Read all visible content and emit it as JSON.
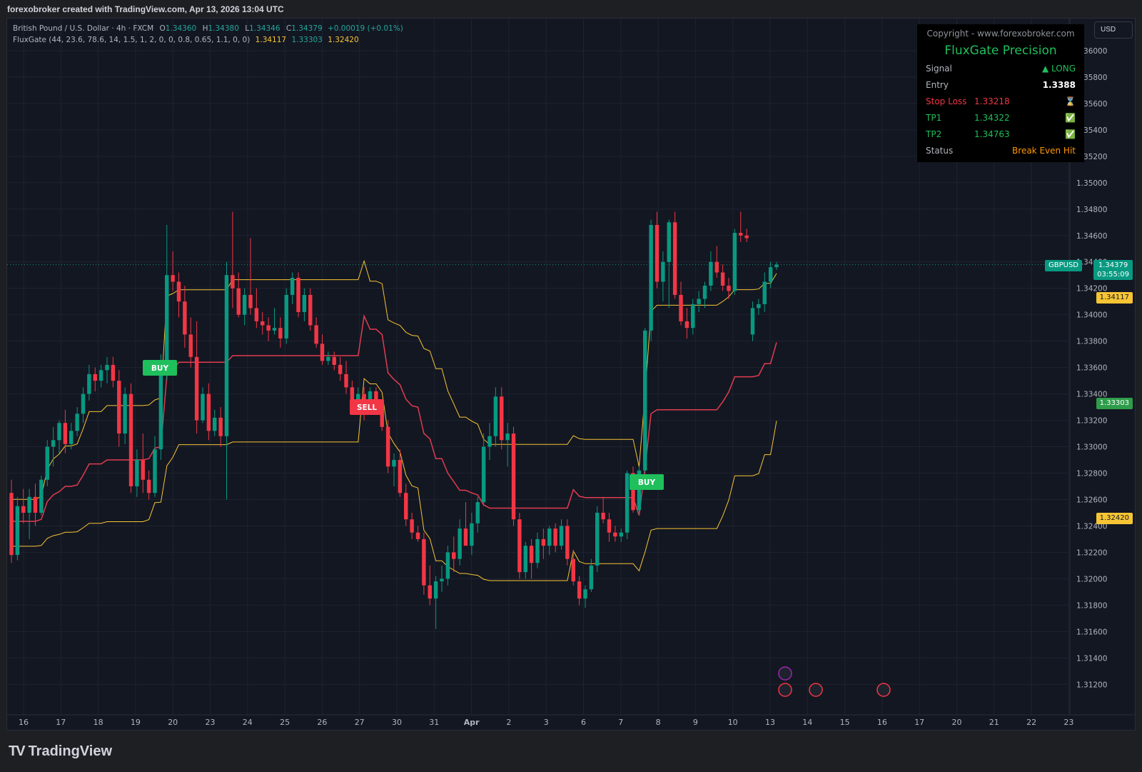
{
  "header": {
    "caption": "forexobroker created with TradingView.com, Apr 13, 2026 13:04 UTC"
  },
  "legend": {
    "symbol_line": "British Pound / U.S. Dollar · 4h · FXCM",
    "o_label": "O",
    "o": "1.34360",
    "h_label": "H",
    "h": "1.34380",
    "l_label": "L",
    "l": "1.34346",
    "c_label": "C",
    "c": "1.34379",
    "change": "+0.00019 (+0.01%)",
    "indicator": "FluxGate (44, 23.6, 78.6, 14, 1.5, 1, 2, 0, 0, 0.8, 0.65, 1.1, 0, 0)",
    "ind_v1": "1.34117",
    "ind_v2": "1.33303",
    "ind_v3": "1.32420"
  },
  "currency_button": "USD",
  "panel": {
    "copyright": "Copyright - www.forexobroker.com",
    "title": "FluxGate Precision",
    "rows": [
      {
        "label": "Signal",
        "mid": "",
        "value": "▲ LONG",
        "color": "#1fbf5c"
      },
      {
        "label": "Entry",
        "mid": "",
        "value": "1.3388",
        "color": "#ffffff"
      },
      {
        "label": "Stop Loss",
        "mid": "1.33218",
        "value": "⌛",
        "color": "#f7c534"
      },
      {
        "label": "TP1",
        "mid": "1.34322",
        "value": "✅",
        "color": "#1fbf5c"
      },
      {
        "label": "TP2",
        "mid": "1.34763",
        "value": "✅",
        "color": "#1fbf5c"
      },
      {
        "label": "Status",
        "mid": "",
        "value": "Break Even Hit",
        "color": "#ff9800"
      }
    ],
    "label_colors": [
      "#b2b5be",
      "#b2b5be",
      "#f23645",
      "#1fbf5c",
      "#1fbf5c",
      "#b2b5be"
    ]
  },
  "price_tags": {
    "symbol": "GBPUSD",
    "last": "1.34379",
    "countdown": "03:55:09",
    "upper": "1.34117",
    "mid": "1.33303",
    "lower": "1.32420"
  },
  "signals": {
    "buy": "BUY",
    "sell": "SELL"
  },
  "footer": {
    "brand": "TradingView"
  },
  "chart_data": {
    "type": "candlestick",
    "timeframe": "4h",
    "ylim": [
      1.3105,
      1.362
    ],
    "y_ticks": [
      "1.36000",
      "1.35800",
      "1.35600",
      "1.35400",
      "1.35200",
      "1.35000",
      "1.34800",
      "1.34600",
      "1.34400",
      "1.34200",
      "1.34000",
      "1.33800",
      "1.33600",
      "1.33400",
      "1.33200",
      "1.33000",
      "1.32800",
      "1.32600",
      "1.32400",
      "1.32200",
      "1.32000",
      "1.31800",
      "1.31600",
      "1.31400",
      "1.31200"
    ],
    "x_ticks": [
      "16",
      "17",
      "18",
      "19",
      "20",
      "23",
      "24",
      "25",
      "26",
      "27",
      "30",
      "31",
      "Apr",
      "2",
      "3",
      "6",
      "7",
      "8",
      "9",
      "10",
      "13",
      "14",
      "15",
      "16",
      "17",
      "20",
      "21",
      "22",
      "23"
    ],
    "last_price": 1.34379,
    "candles": [
      [
        1.3265,
        1.3275,
        1.3212,
        1.3218
      ],
      [
        1.3218,
        1.3262,
        1.3214,
        1.3255
      ],
      [
        1.3255,
        1.3268,
        1.3242,
        1.325
      ],
      [
        1.325,
        1.3268,
        1.323,
        1.3262
      ],
      [
        1.3262,
        1.3272,
        1.324,
        1.325
      ],
      [
        1.325,
        1.3278,
        1.3248,
        1.3275
      ],
      [
        1.3275,
        1.3305,
        1.327,
        1.33
      ],
      [
        1.33,
        1.3315,
        1.3285,
        1.3305
      ],
      [
        1.3305,
        1.332,
        1.3295,
        1.3318
      ],
      [
        1.3318,
        1.3328,
        1.3295,
        1.3302
      ],
      [
        1.3302,
        1.3318,
        1.3298,
        1.3312
      ],
      [
        1.3312,
        1.333,
        1.3308,
        1.3325
      ],
      [
        1.3325,
        1.3345,
        1.3318,
        1.334
      ],
      [
        1.334,
        1.3362,
        1.3335,
        1.3355
      ],
      [
        1.3355,
        1.336,
        1.3342,
        1.335
      ],
      [
        1.335,
        1.3362,
        1.3345,
        1.3358
      ],
      [
        1.3358,
        1.3368,
        1.3348,
        1.3362
      ],
      [
        1.3362,
        1.3368,
        1.3345,
        1.335
      ],
      [
        1.335,
        1.3358,
        1.33,
        1.331
      ],
      [
        1.331,
        1.3345,
        1.3302,
        1.334
      ],
      [
        1.334,
        1.3348,
        1.3265,
        1.327
      ],
      [
        1.327,
        1.3298,
        1.3262,
        1.329
      ],
      [
        1.329,
        1.331,
        1.3265,
        1.3275
      ],
      [
        1.3275,
        1.3282,
        1.326,
        1.3265
      ],
      [
        1.3265,
        1.3308,
        1.3262,
        1.3298
      ],
      [
        1.3298,
        1.337,
        1.329,
        1.3355
      ],
      [
        1.3355,
        1.3468,
        1.335,
        1.343
      ],
      [
        1.343,
        1.3448,
        1.3418,
        1.3425
      ],
      [
        1.3425,
        1.3432,
        1.3398,
        1.341
      ],
      [
        1.341,
        1.3422,
        1.3375,
        1.3385
      ],
      [
        1.3385,
        1.3398,
        1.336,
        1.3368
      ],
      [
        1.3368,
        1.3395,
        1.331,
        1.332
      ],
      [
        1.332,
        1.3345,
        1.3318,
        1.334
      ],
      [
        1.334,
        1.3348,
        1.3305,
        1.3312
      ],
      [
        1.3312,
        1.3328,
        1.3308,
        1.3322
      ],
      [
        1.3322,
        1.333,
        1.33,
        1.3308
      ],
      [
        1.3308,
        1.344,
        1.326,
        1.343
      ],
      [
        1.343,
        1.3478,
        1.3405,
        1.342
      ],
      [
        1.342,
        1.3432,
        1.3398,
        1.34
      ],
      [
        1.34,
        1.342,
        1.3392,
        1.3415
      ],
      [
        1.3415,
        1.3458,
        1.34,
        1.3405
      ],
      [
        1.3405,
        1.342,
        1.339,
        1.3395
      ],
      [
        1.3395,
        1.3402,
        1.3385,
        1.3392
      ],
      [
        1.3392,
        1.3398,
        1.338,
        1.3388
      ],
      [
        1.3388,
        1.3405,
        1.3385,
        1.339
      ],
      [
        1.339,
        1.3398,
        1.3375,
        1.3382
      ],
      [
        1.3382,
        1.342,
        1.3378,
        1.3415
      ],
      [
        1.3415,
        1.3432,
        1.3408,
        1.3428
      ],
      [
        1.3428,
        1.3432,
        1.3398,
        1.3402
      ],
      [
        1.3402,
        1.342,
        1.3395,
        1.3415
      ],
      [
        1.3415,
        1.342,
        1.3388,
        1.3392
      ],
      [
        1.3392,
        1.3398,
        1.3375,
        1.3378
      ],
      [
        1.3378,
        1.3385,
        1.3362,
        1.3365
      ],
      [
        1.3365,
        1.3372,
        1.3362,
        1.3368
      ],
      [
        1.3368,
        1.3372,
        1.3358,
        1.3362
      ],
      [
        1.3362,
        1.3368,
        1.335,
        1.3355
      ],
      [
        1.3355,
        1.3365,
        1.334,
        1.3345
      ],
      [
        1.3345,
        1.335,
        1.333,
        1.3335
      ],
      [
        1.3335,
        1.3345,
        1.3328,
        1.334
      ],
      [
        1.334,
        1.3345,
        1.332,
        1.333
      ],
      [
        1.333,
        1.3345,
        1.3325,
        1.3342
      ],
      [
        1.3342,
        1.3345,
        1.3325,
        1.333
      ],
      [
        1.333,
        1.3335,
        1.3312,
        1.3315
      ],
      [
        1.3315,
        1.332,
        1.328,
        1.3285
      ],
      [
        1.3285,
        1.3295,
        1.327,
        1.329
      ],
      [
        1.329,
        1.3298,
        1.3262,
        1.3265
      ],
      [
        1.3265,
        1.3272,
        1.324,
        1.3245
      ],
      [
        1.3245,
        1.325,
        1.323,
        1.3235
      ],
      [
        1.3235,
        1.324,
        1.3228,
        1.323
      ],
      [
        1.323,
        1.3235,
        1.3188,
        1.3195
      ],
      [
        1.3195,
        1.321,
        1.318,
        1.3185
      ],
      [
        1.3185,
        1.3202,
        1.3162,
        1.3198
      ],
      [
        1.3198,
        1.321,
        1.319,
        1.32
      ],
      [
        1.32,
        1.3225,
        1.3195,
        1.322
      ],
      [
        1.322,
        1.3232,
        1.3205,
        1.3215
      ],
      [
        1.3215,
        1.3245,
        1.321,
        1.3238
      ],
      [
        1.3238,
        1.3258,
        1.3228,
        1.3225
      ],
      [
        1.3225,
        1.325,
        1.3218,
        1.3242
      ],
      [
        1.3242,
        1.3262,
        1.3235,
        1.3258
      ],
      [
        1.3258,
        1.331,
        1.3255,
        1.33
      ],
      [
        1.33,
        1.3318,
        1.329,
        1.3308
      ],
      [
        1.3308,
        1.3345,
        1.33,
        1.3338
      ],
      [
        1.3338,
        1.3345,
        1.3298,
        1.3305
      ],
      [
        1.3305,
        1.3318,
        1.3285,
        1.331
      ],
      [
        1.331,
        1.3315,
        1.324,
        1.3245
      ],
      [
        1.3245,
        1.325,
        1.32,
        1.3205
      ],
      [
        1.3205,
        1.3228,
        1.32,
        1.3225
      ],
      [
        1.3225,
        1.323,
        1.32,
        1.3212
      ],
      [
        1.3212,
        1.3235,
        1.3208,
        1.323
      ],
      [
        1.323,
        1.3238,
        1.3215,
        1.3225
      ],
      [
        1.3225,
        1.324,
        1.3218,
        1.3238
      ],
      [
        1.3238,
        1.3242,
        1.322,
        1.3225
      ],
      [
        1.3225,
        1.3245,
        1.3222,
        1.324
      ],
      [
        1.324,
        1.3245,
        1.321,
        1.3215
      ],
      [
        1.3215,
        1.3222,
        1.3195,
        1.3198
      ],
      [
        1.3198,
        1.3202,
        1.318,
        1.3185
      ],
      [
        1.3185,
        1.3195,
        1.3178,
        1.3192
      ],
      [
        1.3192,
        1.3215,
        1.319,
        1.321
      ],
      [
        1.321,
        1.3255,
        1.3205,
        1.325
      ],
      [
        1.325,
        1.3262,
        1.3242,
        1.3245
      ],
      [
        1.3245,
        1.325,
        1.3228,
        1.3235
      ],
      [
        1.3235,
        1.324,
        1.3228,
        1.3232
      ],
      [
        1.3232,
        1.3238,
        1.3228,
        1.3235
      ],
      [
        1.3235,
        1.3282,
        1.323,
        1.328
      ],
      [
        1.328,
        1.3285,
        1.325,
        1.3252
      ],
      [
        1.3252,
        1.3285,
        1.3248,
        1.3282
      ],
      [
        1.3282,
        1.339,
        1.328,
        1.3388
      ],
      [
        1.3388,
        1.3472,
        1.338,
        1.3468
      ],
      [
        1.3468,
        1.3478,
        1.342,
        1.3425
      ],
      [
        1.3425,
        1.3448,
        1.341,
        1.344
      ],
      [
        1.344,
        1.3472,
        1.3405,
        1.347
      ],
      [
        1.347,
        1.3478,
        1.3412,
        1.3415
      ],
      [
        1.3415,
        1.3425,
        1.3392,
        1.3395
      ],
      [
        1.3395,
        1.3405,
        1.3382,
        1.339
      ],
      [
        1.339,
        1.3412,
        1.3385,
        1.3408
      ],
      [
        1.3408,
        1.3418,
        1.3402,
        1.3412
      ],
      [
        1.3412,
        1.3425,
        1.3405,
        1.3422
      ],
      [
        1.3422,
        1.3448,
        1.3418,
        1.344
      ],
      [
        1.344,
        1.3452,
        1.3428,
        1.3432
      ],
      [
        1.3432,
        1.3438,
        1.3418,
        1.3422
      ],
      [
        1.3422,
        1.3428,
        1.3412,
        1.3418
      ],
      [
        1.3418,
        1.3465,
        1.3415,
        1.3462
      ],
      [
        1.3462,
        1.3478,
        1.3455,
        1.346
      ],
      [
        1.346,
        1.3465,
        1.3455,
        1.3458
      ],
      [
        1.3385,
        1.341,
        1.338,
        1.3405
      ],
      [
        1.3405,
        1.3412,
        1.34,
        1.3408
      ],
      [
        1.3408,
        1.3432,
        1.3402,
        1.3425
      ],
      [
        1.3425,
        1.344,
        1.342,
        1.3436
      ],
      [
        1.3436,
        1.344,
        1.3434,
        1.3438
      ]
    ],
    "bands": {
      "upper_yellow": "1.34117",
      "mid_line": "1.33303",
      "lower_yellow": "1.32420"
    }
  }
}
